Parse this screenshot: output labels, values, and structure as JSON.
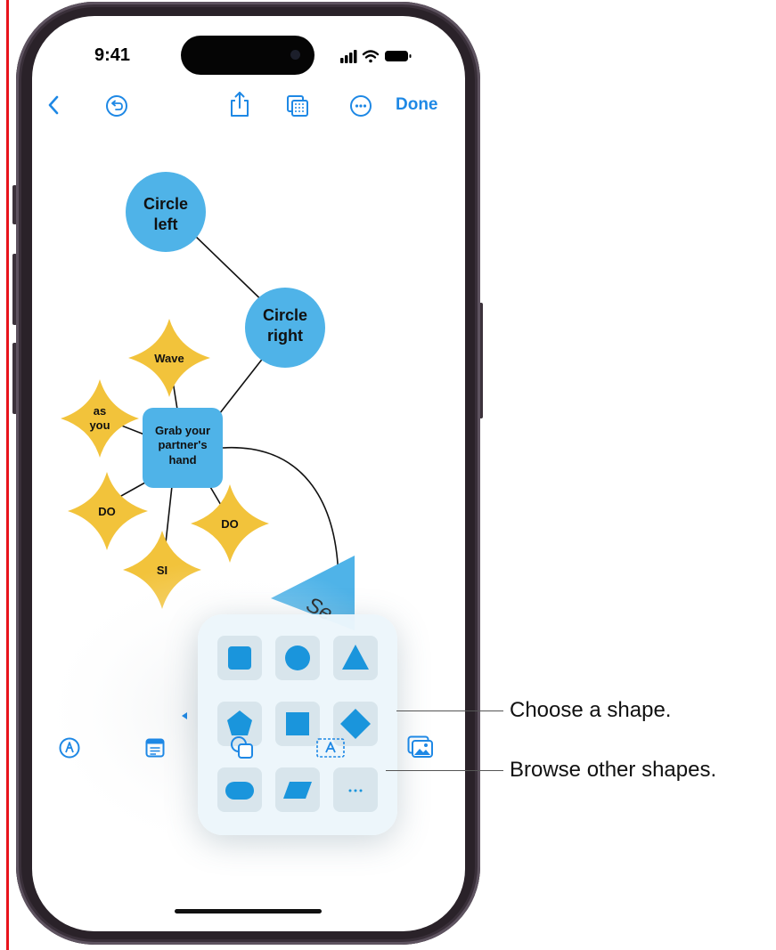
{
  "status_bar": {
    "time": "9:41"
  },
  "top_toolbar": {
    "done_label": "Done"
  },
  "canvas": {
    "nodes": {
      "circle_left": "Circle\nleft",
      "circle_right": "Circle\nright",
      "wave": "Wave",
      "as_you": "as\nyou",
      "center_box": "Grab your\npartner's\nhand",
      "do_left": "DO",
      "do_right": "DO",
      "si": "SI",
      "triangle_text": "Se"
    }
  },
  "shape_palette": {
    "shapes": [
      "square",
      "circle",
      "triangle",
      "pentagon",
      "square",
      "diamond",
      "rounded-rectangle",
      "parallelogram",
      "more"
    ]
  },
  "callouts": {
    "choose_shape": "Choose a shape.",
    "browse_shapes": "Browse other shapes."
  },
  "colors": {
    "accent": "#1e88e5",
    "shape_blue": "#4fb3e8",
    "star_yellow": "#f2c33b",
    "palette_shape": "#1a95dc"
  }
}
